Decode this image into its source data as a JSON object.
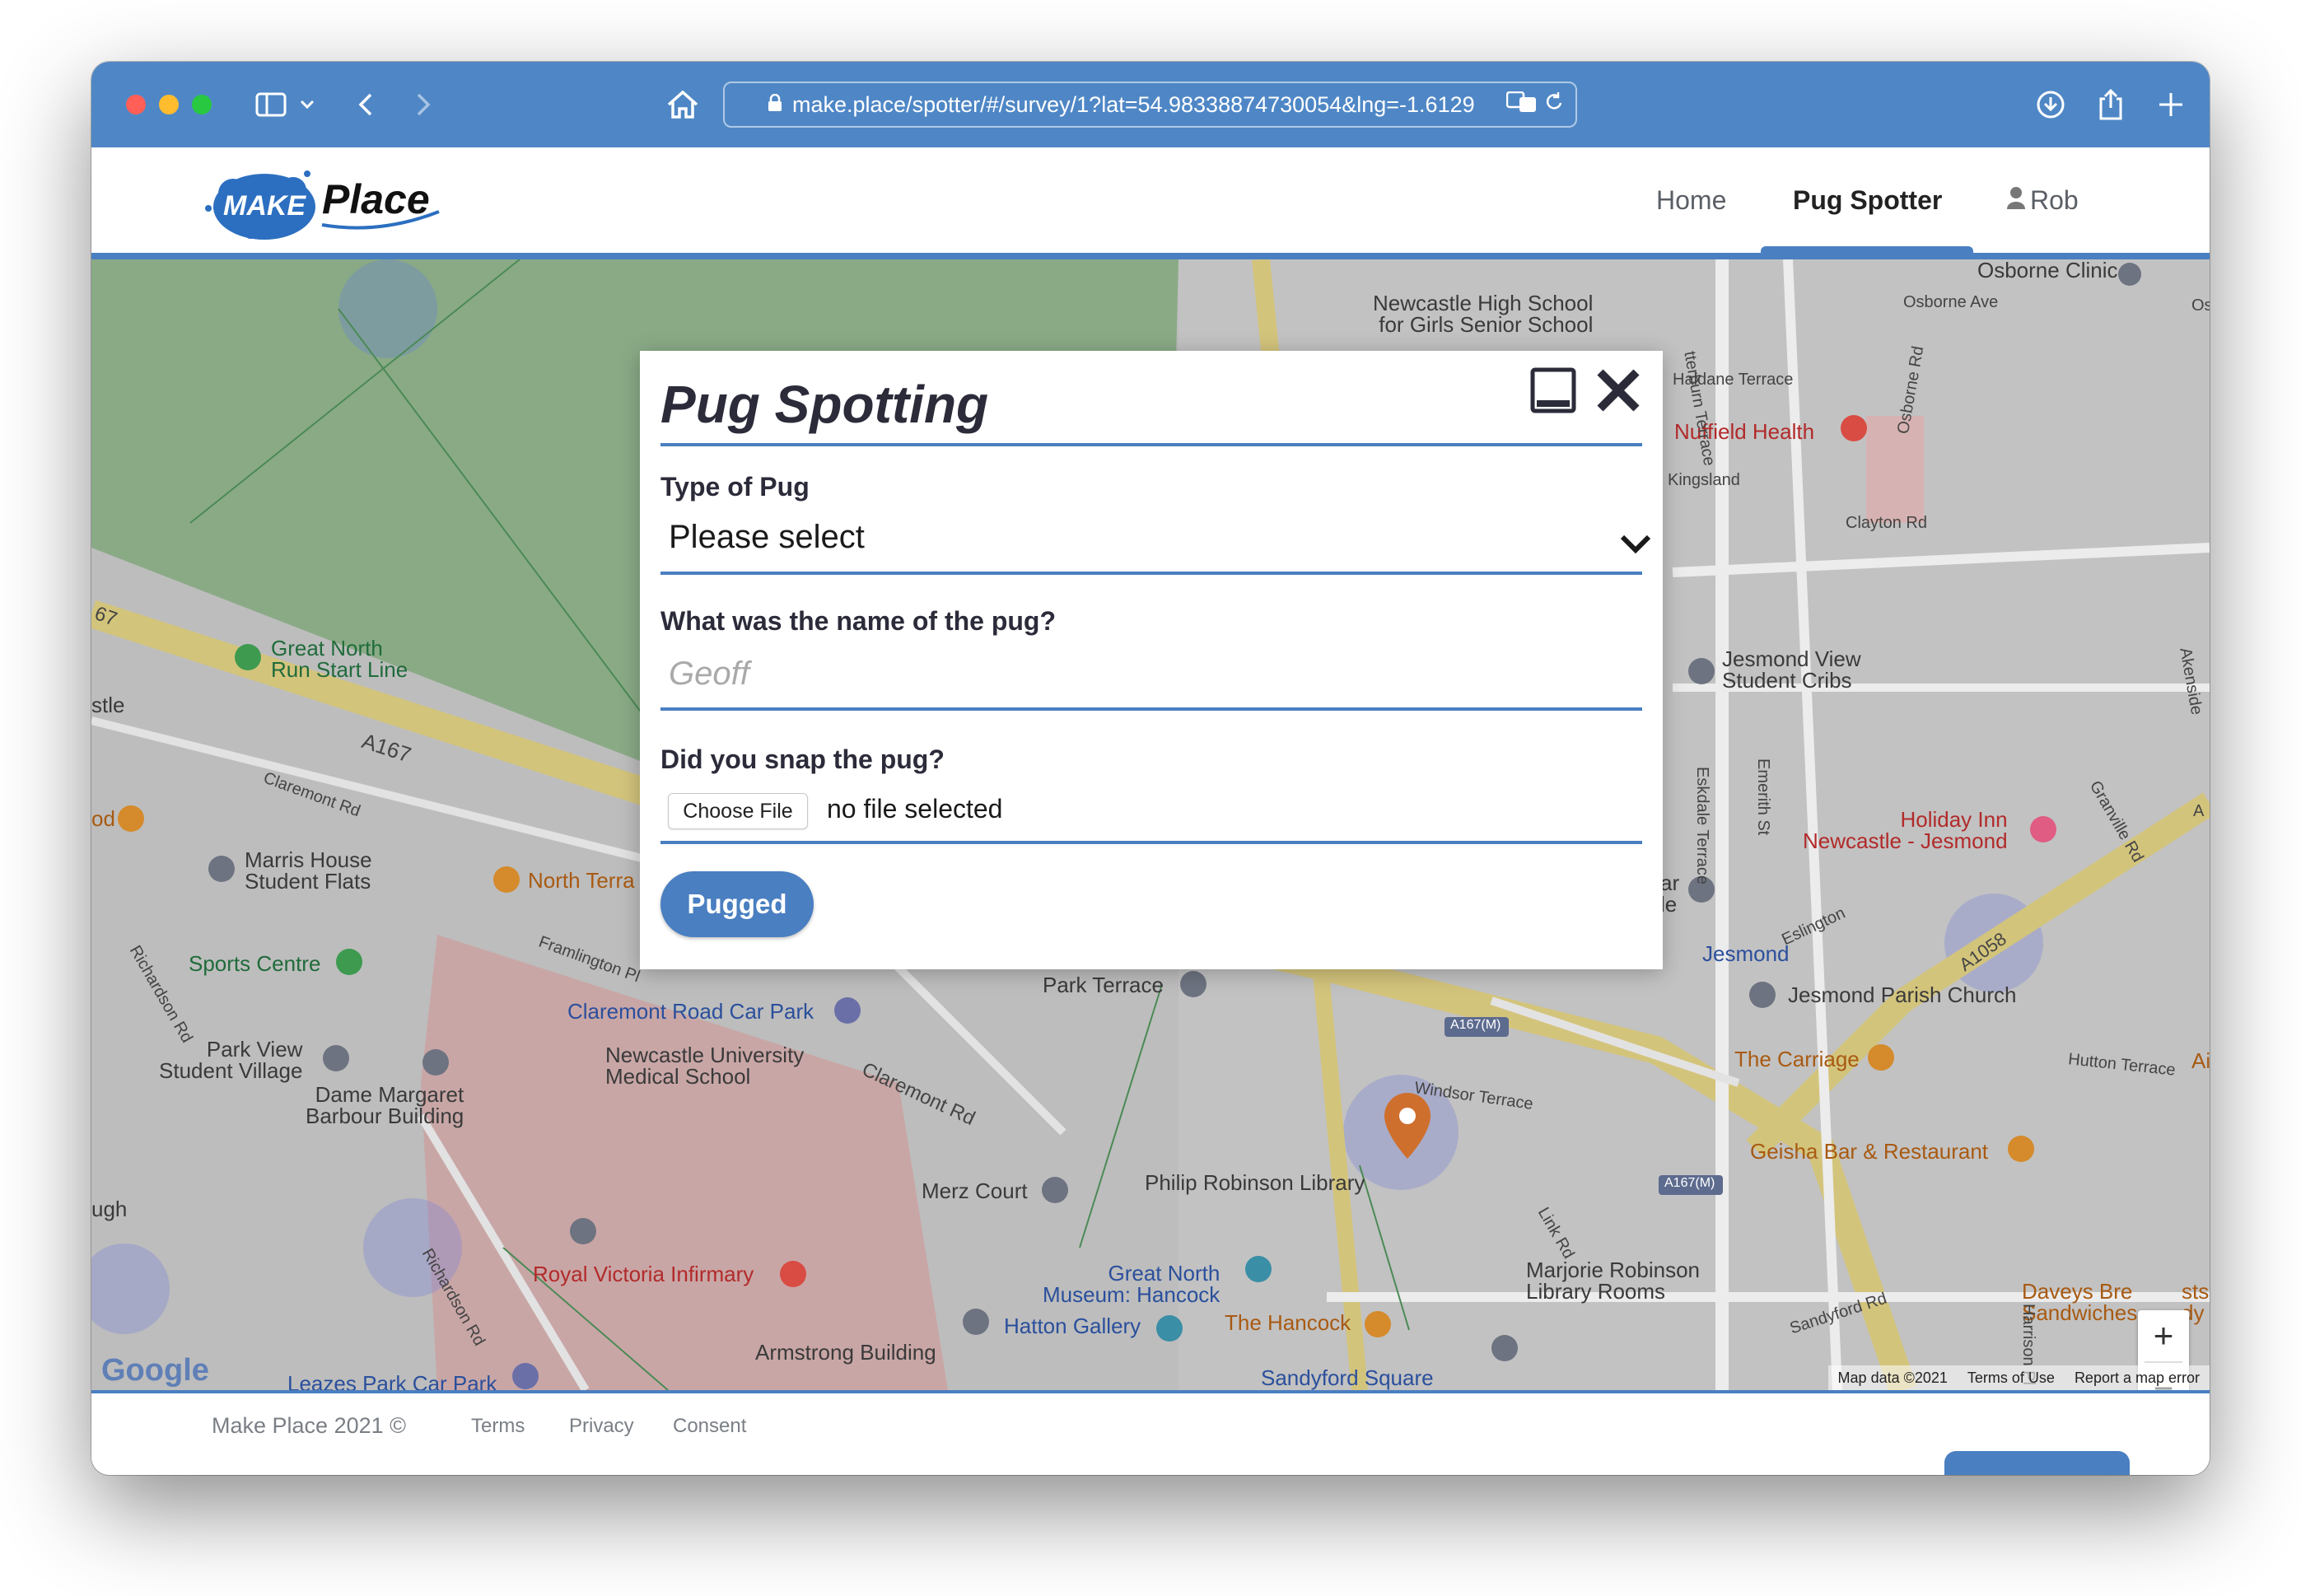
{
  "browser": {
    "url": "make.place/spotter/#/survey/1?lat=54.98338874730054&lng=-1.6129",
    "colors": {
      "toolbar": "#4f87c6",
      "close": "#ff5f57",
      "minimize": "#febc2e",
      "zoom": "#28c840"
    }
  },
  "site": {
    "logo_make": "MAKE",
    "logo_place": "Place",
    "nav": {
      "home": "Home",
      "spotter": "Pug Spotter",
      "user": "Rob"
    },
    "accent": "#4a7fc1"
  },
  "map": {
    "labels": {
      "great_north_run": [
        "Great North",
        "Run Start Line"
      ],
      "marris_house": [
        "Marris House",
        "Student Flats"
      ],
      "sports_centre": "Sports Centre",
      "park_view": [
        "Park View",
        "Student Village"
      ],
      "dame_margaret": [
        "Dame Margaret",
        "Barbour Building"
      ],
      "claremont_car_park": "Claremont Road Car Park",
      "med_school": [
        "Newcastle University",
        "Medical School"
      ],
      "park_terrace": "Park Terrace",
      "merz_court": "Merz Court",
      "philip_robinson": "Philip Robinson Library",
      "great_north_museum": [
        "Great North",
        "Museum: Hancock"
      ],
      "royal_victoria": "Royal Victoria Infirmary",
      "armstrong": "Armstrong Building",
      "hatton": "Hatton Gallery",
      "the_hancock": "The Hancock",
      "marjorie": [
        "Marjorie Robinson",
        "Library Rooms"
      ],
      "sandyford_square": "Sandyford Square",
      "leazes": "Leazes Park Car Park",
      "newcastle_high": [
        "Newcastle High School",
        "for Girls Senior School"
      ],
      "nuffield": "Nuffield Health",
      "kingsland": "Kingsland",
      "clayton_rd": "Clayton Rd",
      "haldane": "Haldane Terrace",
      "osborne_rd": "Osborne Rd",
      "osborne_ave": "Osborne Ave",
      "osborne_clinic": "Osborne Clinic",
      "jesmond_view": [
        "Jesmond View",
        "Student Cribs"
      ],
      "holiday_inn": [
        "Holiday Inn",
        "Newcastle - Jesmond"
      ],
      "jesmond": "Jesmond",
      "jesmond_parish": "Jesmond Parish Church",
      "the_carriage": "The Carriage",
      "geisha": "Geisha Bar & Restaurant",
      "daveys": [
        "Daveys Bre",
        "Sandwiches"
      ],
      "sandyford_rd": "Sandyford Rd",
      "a167": "A167",
      "a167m": "A167(M)",
      "a1058": "A1058",
      "claremont_rd": "Claremont Rd",
      "north_terrace": "North Terra",
      "windsor": "Windsor Terrace",
      "hutton": "Hutton Terrace",
      "eskdale": "Eskdale Terrace",
      "emerith": "Emerith St",
      "richardson": "Richardson Rd",
      "framlington": "Framlington Pl",
      "granville": "Granville Rd",
      "harrison": "Harrison Pl",
      "link_rd": "Link Rd",
      "esk": "Eslington",
      "stle": "stle",
      "ugh": "ugh",
      "od": "od",
      "n67": "67",
      "ar_le": [
        "ar",
        "le"
      ],
      "terrace_vert": "tterburn Terrace",
      "os": "Os",
      "ak": "Akenside",
      "a_edge": "A",
      "ai_edge": "Ai",
      "dy": "dy",
      "sts": "sts"
    },
    "google": "Google",
    "attribution": {
      "data": "Map data ©2021",
      "terms": "Terms of Use",
      "report": "Report a map error"
    },
    "zoom_in": "+",
    "zoom_out": "−"
  },
  "modal": {
    "title": "Pug Spotting",
    "q1_label": "Type of Pug",
    "q1_value": "Please select",
    "q2_label": "What was the name of the pug?",
    "q2_placeholder": "Geoff",
    "q3_label": "Did you snap the pug?",
    "file_button": "Choose File",
    "file_status": "no file selected",
    "submit": "Pugged"
  },
  "footer": {
    "copyright": "Make Place 2021 ©",
    "terms": "Terms",
    "privacy": "Privacy",
    "consent": "Consent"
  }
}
